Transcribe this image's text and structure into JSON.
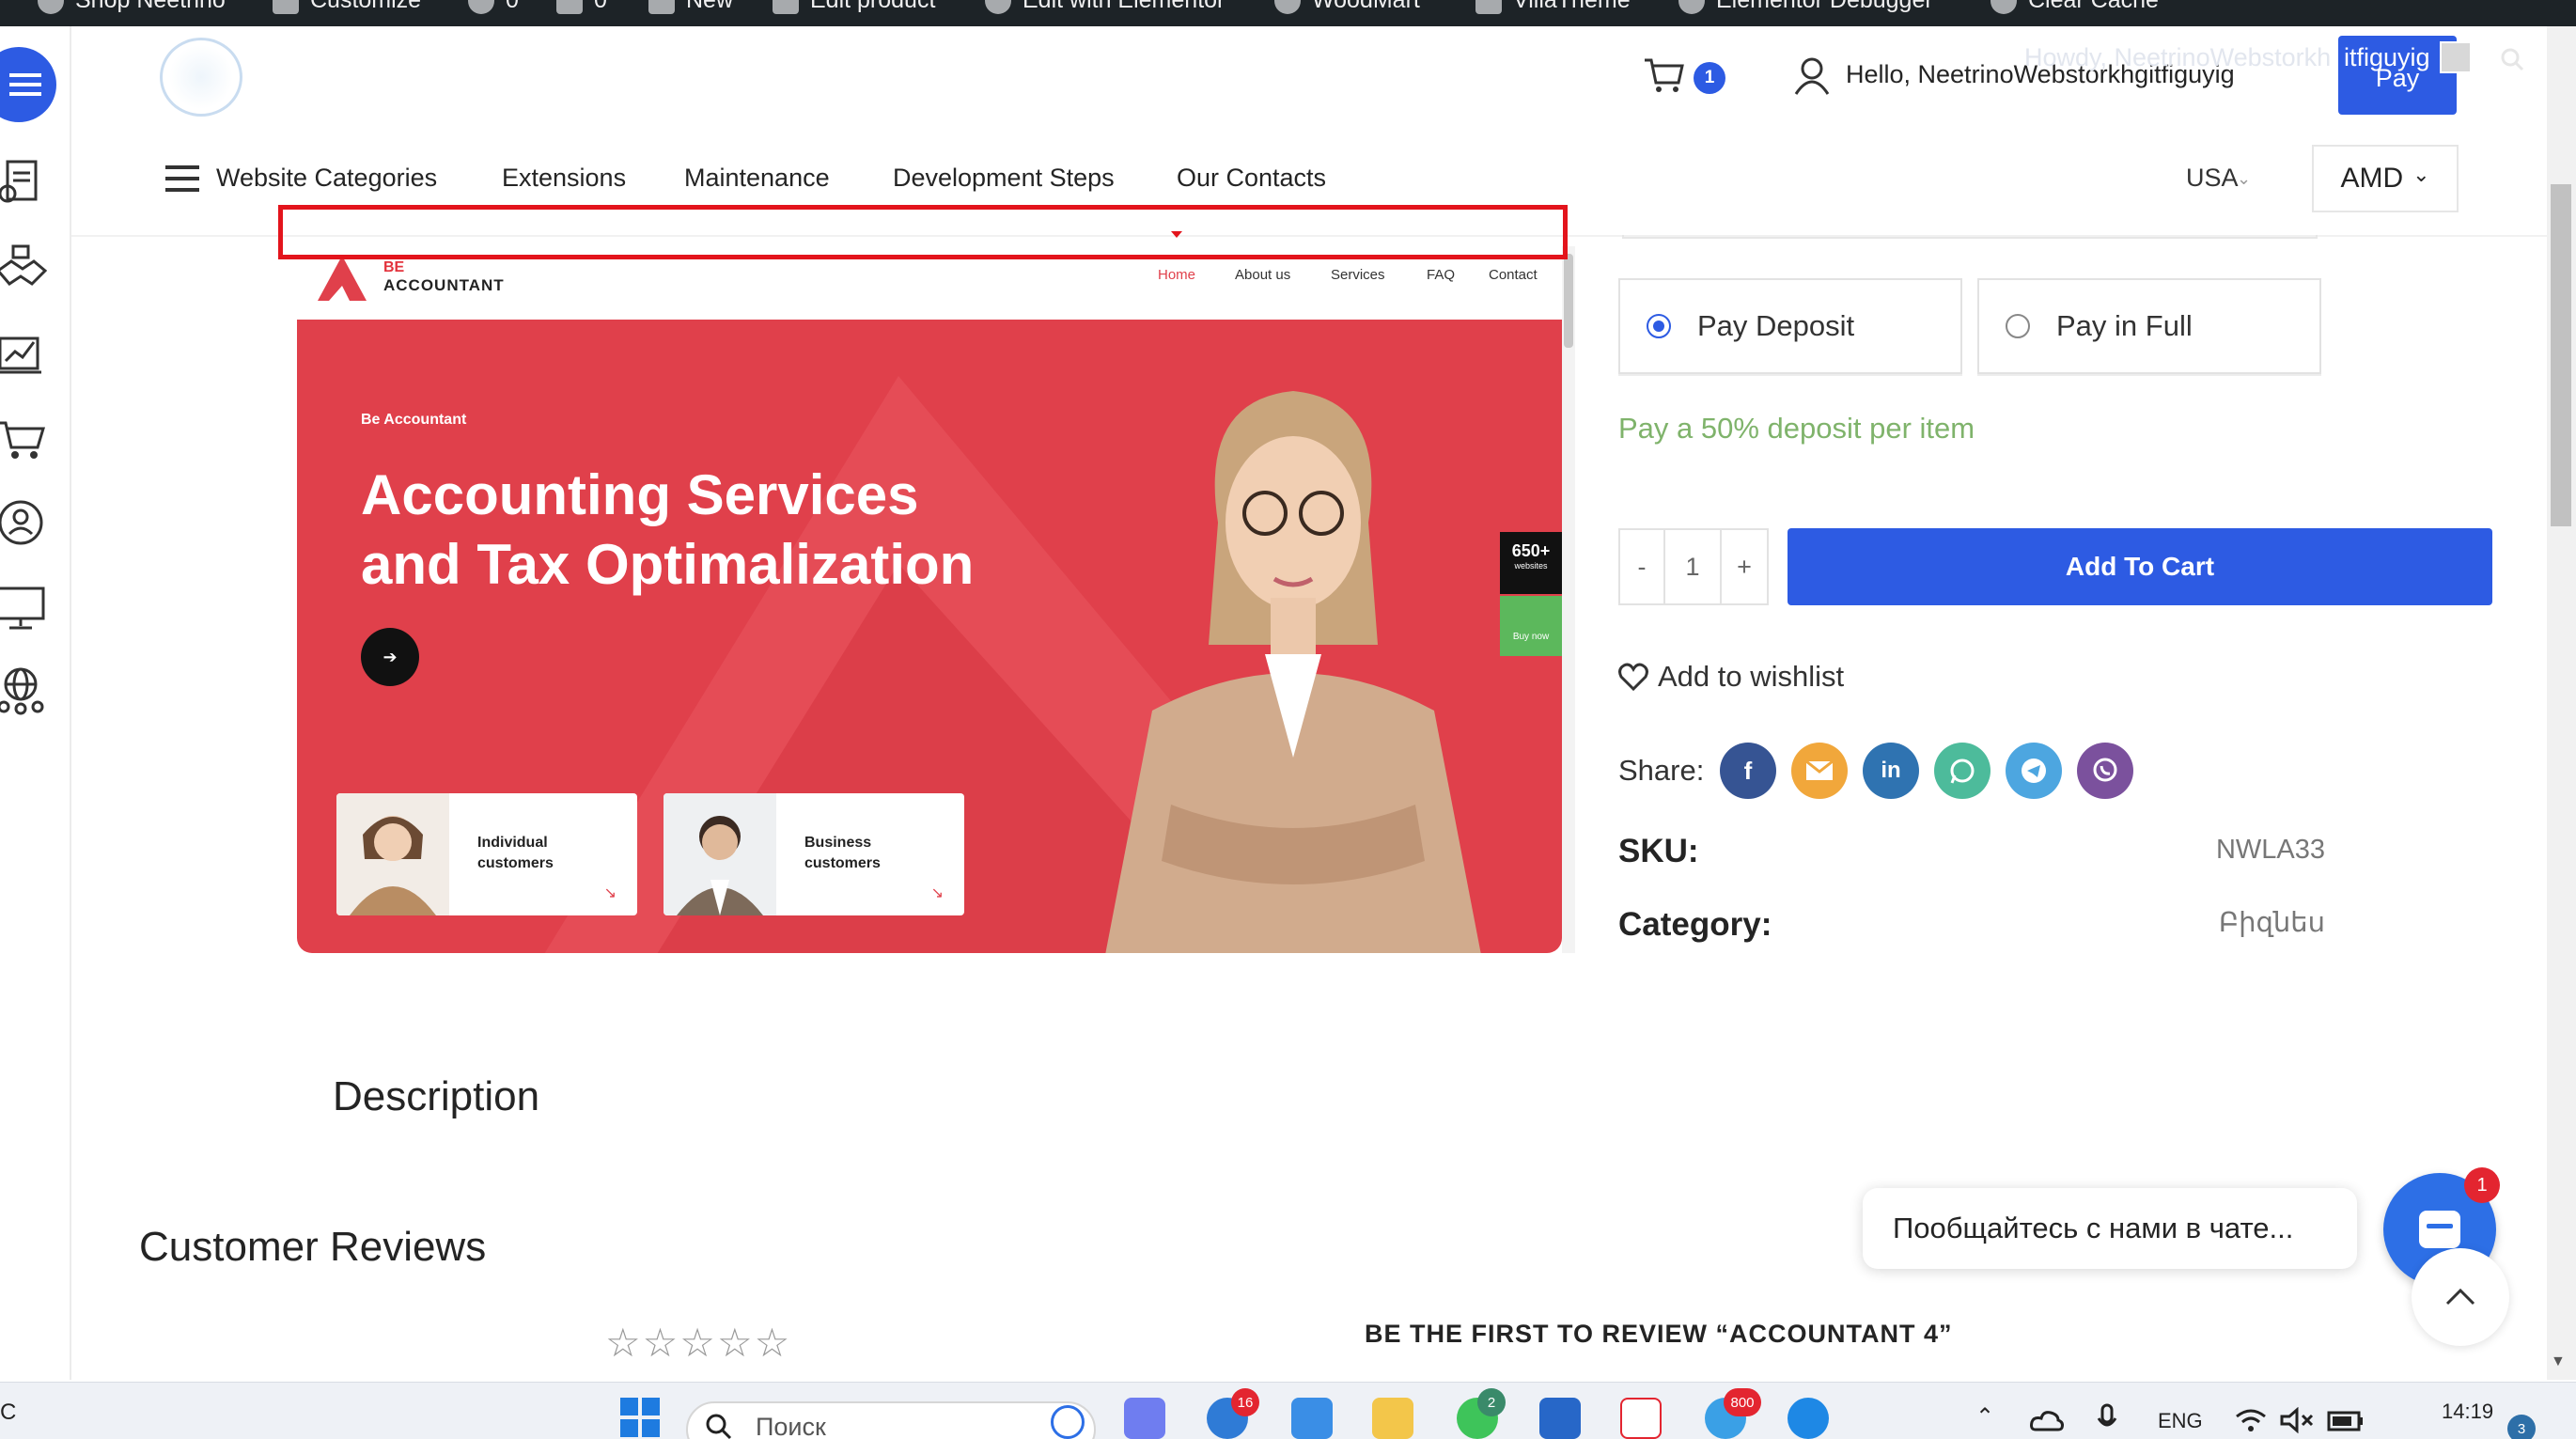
{
  "admin_bar": {
    "items": [
      "Shop Neetrino",
      "Customize",
      "0",
      "0",
      "New",
      "Edit product",
      "Edit with Elementor",
      "WoodMart",
      "VillaTheme",
      "Elementor Debugger",
      "Clear Cache"
    ]
  },
  "sidebar": {
    "icons": [
      "menu-icon",
      "document-icon",
      "handshake-icon",
      "analytics-icon",
      "cart-icon",
      "support-icon",
      "monitor-icon",
      "network-icon"
    ]
  },
  "header": {
    "cart_count": "1",
    "greeting": "Hello, NeetrinoWebstorkhgitfiguyig",
    "ghost_greeting": "Howdy, NeetrinoWebstorkh",
    "ghost_name": "itfiguyig",
    "pay_label": "Pay"
  },
  "nav": {
    "categories_label": "Website Categories",
    "items": [
      "Extensions",
      "Maintenance",
      "Development Steps",
      "Our Contacts"
    ],
    "country": "USA",
    "currency": "AMD"
  },
  "product_image": {
    "logo_line1": "BE",
    "logo_line2": "ACCOUNTANT",
    "menu": [
      "Home",
      "About us",
      "Services",
      "FAQ",
      "Contact"
    ],
    "kicker": "Be Accountant",
    "title_line1": "Accounting Services",
    "title_line2": "and Tax Optimalization",
    "card1": "Individual customers",
    "card2": "Business customers",
    "badge_number": "650+",
    "badge_text": "websites",
    "buy_now": "Buy now"
  },
  "product": {
    "pay_deposit": "Pay Deposit",
    "pay_full": "Pay in Full",
    "deposit_note": "Pay a 50% deposit per item",
    "qty_minus": "-",
    "qty_value": "1",
    "qty_plus": "+",
    "add_to_cart": "Add To Cart",
    "wishlist": "Add to wishlist",
    "share_label": "Share:",
    "share_icons": [
      "facebook-icon",
      "email-icon",
      "linkedin-icon",
      "whatsapp-icon",
      "telegram-icon",
      "viber-icon"
    ],
    "sku_label": "SKU:",
    "sku_value": "NWLA33",
    "category_label": "Category:",
    "category_value": "Բիզնես"
  },
  "sections": {
    "description": "Description",
    "reviews": "Customer Reviews",
    "stars": "☆☆☆☆☆",
    "first_review": "BE THE FIRST TO REVIEW “ACCOUNTANT 4”"
  },
  "chat": {
    "prompt": "Пообщайтесь с нами в чате...",
    "unread": "1"
  },
  "taskbar": {
    "left_char": "C",
    "search_placeholder": "Поиск",
    "badges": [
      "16",
      "2",
      "800"
    ],
    "language": "ENG",
    "time": "14:19",
    "notifications": "3"
  },
  "colors": {
    "accent": "#2d5be3",
    "hero_red": "#e0404b",
    "deposit_green": "#7fb36b",
    "highlight_red": "#e3141c"
  }
}
